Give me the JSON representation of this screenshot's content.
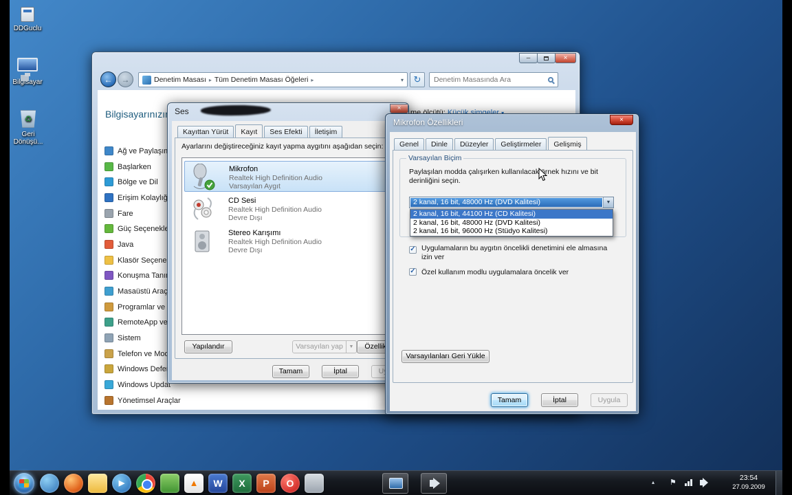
{
  "glyphs": {
    "minimize": "–",
    "close": "×",
    "back_arrow": "←",
    "fwd_arrow": "→",
    "refresh": "↻",
    "breadcrumb_sep": "▸",
    "chevron_down": "▾",
    "combo_arrow": "▼",
    "check": "✓",
    "tray_flag": "⚑",
    "tray_chevron": "▴"
  },
  "desktop": {
    "icons": [
      {
        "label": "DDGuclu",
        "icon": "app-shortcut-icon"
      },
      {
        "label": "Bilgisayar",
        "icon": "computer-icon"
      },
      {
        "label": "Geri Dönüşü...",
        "icon": "recycle-bin-icon"
      }
    ]
  },
  "control_panel": {
    "breadcrumb": {
      "root": "Denetim Masası",
      "page": "Tüm Denetim Masası Öğeleri"
    },
    "search": {
      "placeholder": "Denetim Masasında Ara"
    },
    "heading": "Bilgisayarınızın",
    "view_by": {
      "label_tail": "me ölçütü:",
      "value": "Küçük simgeler"
    },
    "sidebar": [
      {
        "label": "Ağ ve Paylaşım",
        "icon": "network-icon"
      },
      {
        "label": "Başlarken",
        "icon": "getting-started-icon"
      },
      {
        "label": "Bölge ve Dil",
        "icon": "region-language-icon"
      },
      {
        "label": "Erişim Kolaylığı",
        "icon": "ease-of-access-icon"
      },
      {
        "label": "Fare",
        "icon": "mouse-icon"
      },
      {
        "label": "Güç Seçenekleri",
        "icon": "power-options-icon"
      },
      {
        "label": "Java",
        "icon": "java-icon"
      },
      {
        "label": "Klasör Seçenekleri",
        "icon": "folder-options-icon"
      },
      {
        "label": "Konuşma Tanıma",
        "icon": "speech-recognition-icon"
      },
      {
        "label": "Masaüstü Araçları",
        "icon": "desktop-gadgets-icon"
      },
      {
        "label": "Programlar ve",
        "icon": "programs-features-icon"
      },
      {
        "label": "RemoteApp ve",
        "icon": "remoteapp-icon"
      },
      {
        "label": "Sistem",
        "icon": "system-icon"
      },
      {
        "label": "Telefon ve Mod",
        "icon": "phone-modem-icon"
      },
      {
        "label": "Windows Defen",
        "icon": "windows-defender-icon"
      },
      {
        "label": "Windows Updat",
        "icon": "windows-update-icon"
      },
      {
        "label": "Yönetimsel Araçlar",
        "icon": "admin-tools-icon"
      }
    ]
  },
  "sound_dialog": {
    "title": "Ses",
    "tabs": [
      "Kayıttan Yürüt",
      "Kayıt",
      "Ses Efekti",
      "İletişim"
    ],
    "active_tab_index": 1,
    "description": "Ayarlarını değiştireceğiniz kayıt yapma aygıtını aşağıdan seçin:",
    "devices": [
      {
        "name": "Mikrofon",
        "device": "Realtek High Definition Audio",
        "status": "Varsayılan Aygıt",
        "selected": true
      },
      {
        "name": "CD Sesi",
        "device": "Realtek High Definition Audio",
        "status": "Devre Dışı",
        "selected": false
      },
      {
        "name": "Stereo Karışımı",
        "device": "Realtek High Definition Audio",
        "status": "Devre Dışı",
        "selected": false
      }
    ],
    "buttons": {
      "configure": "Yapılandır",
      "set_default": "Varsayılan yap",
      "properties": "Özellikler",
      "ok": "Tamam",
      "cancel": "İptal",
      "apply": "Uygula"
    }
  },
  "mic_dialog": {
    "title": "Mikrofon Özellikleri",
    "tabs": [
      "Genel",
      "Dinle",
      "Düzeyler",
      "Geliştirmeler",
      "Gelişmiş"
    ],
    "active_tab_index": 4,
    "group_title": "Varsayılan Biçim",
    "description": "Paylaşılan modda çalışırken kullanılacak örnek hızını ve bit derinliğini seçin.",
    "format_select": {
      "value": "2 kanal, 16 bit, 48000 Hz (DVD Kalitesi)",
      "options": [
        "2 kanal, 16 bit, 44100 Hz (CD Kalitesi)",
        "2 kanal, 16 bit, 48000 Hz (DVD Kalitesi)",
        "2 kanal, 16 bit, 96000 Hz (Stüdyo Kalitesi)"
      ],
      "highlighted_index": 0
    },
    "checkboxes": [
      {
        "label": "Uygulamaların bu aygıtın öncelikli denetimini ele almasına izin ver",
        "checked": true
      },
      {
        "label": "Özel kullanım modlu uygulamalara öncelik ver",
        "checked": true
      }
    ],
    "restore_defaults": "Varsayılanları Geri Yükle",
    "buttons": {
      "ok": "Tamam",
      "cancel": "İptal",
      "apply": "Uygula"
    }
  },
  "taskbar": {
    "icons": [
      {
        "name": "messenger-icon",
        "glyph": ""
      },
      {
        "name": "firefox-icon",
        "glyph": ""
      },
      {
        "name": "explorer-folder-icon",
        "glyph": ""
      },
      {
        "name": "media-player-icon",
        "glyph": "▶"
      },
      {
        "name": "chrome-icon",
        "glyph": ""
      },
      {
        "name": "green-app-icon",
        "glyph": ""
      },
      {
        "name": "vlc-icon",
        "glyph": "▲"
      },
      {
        "name": "word-icon",
        "glyph": "W"
      },
      {
        "name": "excel-icon",
        "glyph": "X"
      },
      {
        "name": "powerpoint-icon",
        "glyph": "P"
      },
      {
        "name": "opera-icon",
        "glyph": "O"
      },
      {
        "name": "gray-app-icon",
        "glyph": ""
      }
    ],
    "tray": {
      "time": "23:54",
      "date": "27.09.2009"
    }
  }
}
